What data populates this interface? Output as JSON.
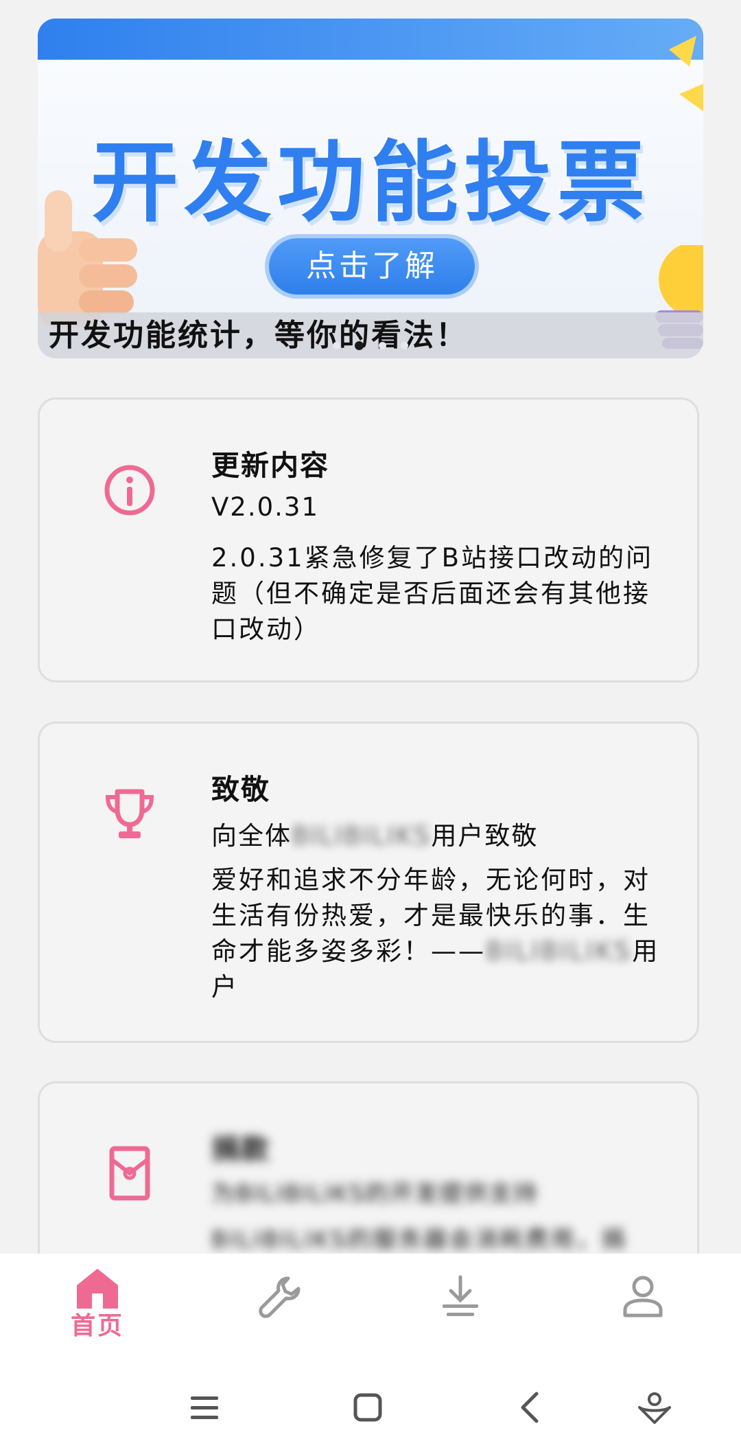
{
  "banner": {
    "headline": "开发功能投票",
    "cta_label": "点击了解",
    "caption": "开发功能统计，等你的看法！",
    "dots": 4,
    "active_dot": 1
  },
  "cards": [
    {
      "icon": "info-icon",
      "title": "更新内容",
      "subtitle": "V2.0.31",
      "body": "2.0.31紧急修复了B站接口改动的问题（但不确定是否后面还会有其他接口改动）"
    },
    {
      "icon": "trophy-icon",
      "title": "致敬",
      "subtitle_prefix": "向全体",
      "subtitle_blurred": "BILIBILIKS",
      "subtitle_suffix": "用户致敬",
      "body_prefix": "爱好和追求不分年龄，无论何时，对生活有份热爱，才是最快乐的事．生命才能多姿多彩！——",
      "body_blurred": "BILIBILIKS",
      "body_suffix": "用户"
    },
    {
      "icon": "red-envelope-icon",
      "title": "捐款",
      "subtitle": "为BILIBILIKS的开发提供支持",
      "body": "BILIBILIKS的服务器会消耗费用，捐"
    }
  ],
  "bottom_nav": {
    "items": [
      {
        "icon": "home-icon",
        "label": "首页",
        "active": true
      },
      {
        "icon": "wrench-icon",
        "label": "",
        "active": false
      },
      {
        "icon": "download-icon",
        "label": "",
        "active": false
      },
      {
        "icon": "user-icon",
        "label": "",
        "active": false
      }
    ]
  },
  "system_nav": [
    "menu-icon",
    "home-square-icon",
    "back-icon",
    "assistant-icon"
  ],
  "colors": {
    "accent": "#ef6a93",
    "banner_blue": "#2f7ff0",
    "background": "#f2f2f2"
  }
}
